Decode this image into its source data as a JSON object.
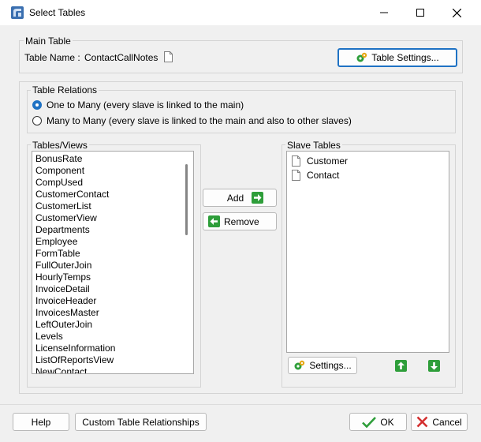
{
  "window": {
    "title": "Select Tables"
  },
  "main_table": {
    "legend": "Main Table",
    "name_label": "Table Name :",
    "name_value": "ContactCallNotes",
    "settings_button": "Table Settings..."
  },
  "relations": {
    "legend": "Table Relations",
    "options": [
      {
        "label": "One to Many (every slave is linked to the main)",
        "selected": true
      },
      {
        "label": "Many to Many (every slave is linked to the main and also to other slaves)",
        "selected": false
      }
    ]
  },
  "tables_views": {
    "legend": "Tables/Views",
    "items": [
      "BonusRate",
      "Component",
      "CompUsed",
      "CustomerContact",
      "CustomerList",
      "CustomerView",
      "Departments",
      "Employee",
      "FormTable",
      "FullOuterJoin",
      "HourlyTemps",
      "InvoiceDetail",
      "InvoiceHeader",
      "InvoicesMaster",
      "LeftOuterJoin",
      "Levels",
      "LicenseInformation",
      "ListOfReportsView",
      "NewContact"
    ]
  },
  "middle_buttons": {
    "add": "Add",
    "remove": "Remove"
  },
  "slave_tables": {
    "legend": "Slave Tables",
    "items": [
      "Customer",
      "Contact"
    ],
    "settings_button": "Settings..."
  },
  "footer": {
    "help": "Help",
    "custom_relationships": "Custom Table Relationships",
    "ok": "OK",
    "cancel": "Cancel"
  },
  "colors": {
    "accent": "#1f72c4",
    "green": "#2e9e3a",
    "red": "#d32f2f"
  }
}
